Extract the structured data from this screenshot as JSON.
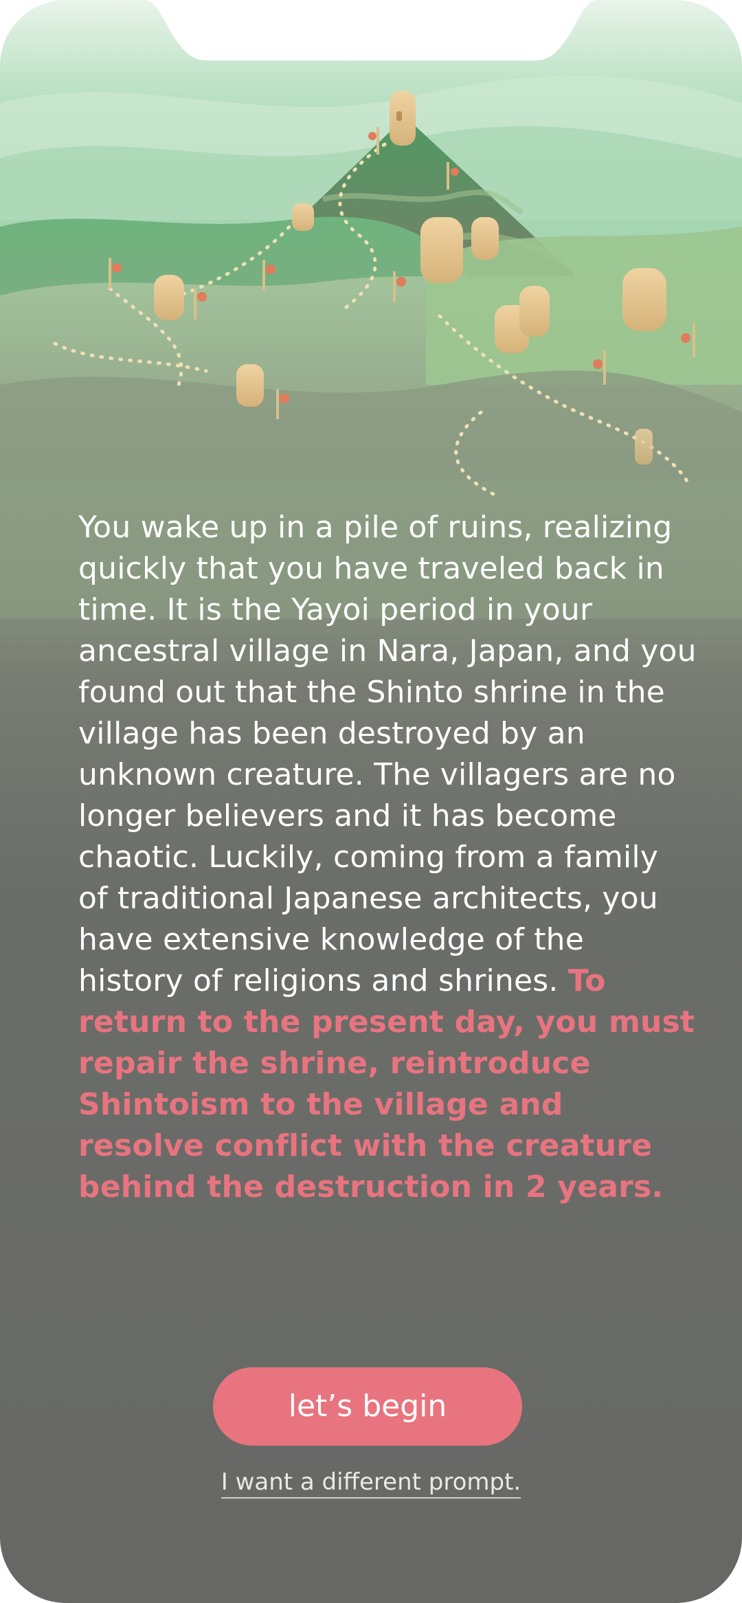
{
  "intro": {
    "story_text": "You wake up in a pile of ruins, realizing quickly that you have traveled back in time. It is the Yayoi period in your ancestral village in Nara, Japan, and you found out that the Shinto shrine in the village has been destroyed by an unknown creature. The villagers are no longer believers and it has become chaotic. Luckily, coming from a family of traditional Japanese architects, you have extensive knowledge of the history of religions and shrines. ",
    "goal_text": "To return to the present day, you must repair the shrine, reintroduce Shintoism to the village and resolve conflict with the creature behind the destruction in 2 years."
  },
  "actions": {
    "begin_label": "let’s begin",
    "different_prompt_label": "I want a different prompt."
  },
  "colors": {
    "accent": "#e8747f",
    "text": "#ffffff",
    "background_bottom": "#676865",
    "hills": "#8fc39d"
  },
  "illustration": {
    "icons": [
      "mountain-shrine-icon",
      "village-hut-icon",
      "lantern-post-icon",
      "dotted-path-icon"
    ]
  }
}
